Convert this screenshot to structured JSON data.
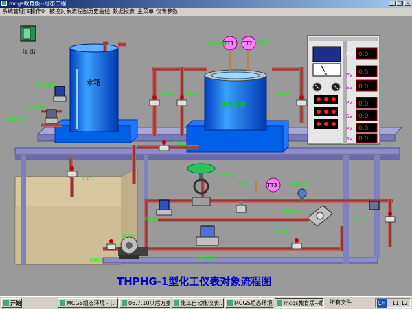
{
  "window": {
    "title": "mcgs教育版--组态工程",
    "minimize": "_",
    "maximize": "□",
    "close": "×"
  },
  "menu": {
    "items": [
      "系统管理[S]",
      "操作0",
      "被控对象流程图",
      "历史曲线",
      "数据报表",
      "主菜单",
      "仪表参数"
    ]
  },
  "diagram": {
    "title": "THPHG-1型化工仪表对象流程图",
    "exit_label": "退 出",
    "tanks": {
      "water_tank": "水箱",
      "reactor": "夹套水箱"
    },
    "sensors": {
      "tt1": "TT1",
      "tt2": "TT2",
      "tt3": "TT3"
    },
    "flow_tags": {
      "f1_3": "F1-3",
      "f1_4": "F1-4",
      "f1_5": "F1-5",
      "f1_6": "F1-6",
      "f1_7": "F1-7",
      "f1_1": "F1-1",
      "f1_2": "F1-2"
    },
    "device_labels": {
      "motor_valve": "电动调节阀",
      "inlet_valve": "进水电磁阀",
      "drain_valve": "泄水电磁阀",
      "level_sensor": "液位变送器",
      "temp_sensor": "温度传感器",
      "pressure": "压力变送器",
      "turbine": "涡轮流量计",
      "electromag": "电磁流量计",
      "pump": "磁力泵",
      "heater": "加热器",
      "cooling": "冷却水",
      "elec_valve": "电磁阀",
      "flow_sensor": "流量计"
    }
  },
  "panel": {
    "display_1": "0.0",
    "display_2": "0.0",
    "display_3": "0.0",
    "display_4": "0.0",
    "display_5": "0.0",
    "display_6": "0.0",
    "display_7": "0.0",
    "pv": "PV",
    "sv": "SV"
  },
  "taskbar": {
    "start": "开始",
    "tasks": [
      "MCGS组态环境 - [...",
      "06.7.10以后方案",
      "化工自动化仪表...",
      "MCGS组态环境 - [...",
      "mcgs教育版--组..."
    ],
    "all_files": "所有文件",
    "lang": "CH",
    "time": "11:12"
  },
  "colors": {
    "tank_blue": "#1E78FF",
    "pipe": "#A0504A",
    "frame": "#8080C0",
    "label_green": "#00CC00",
    "title_blue": "#0000CC"
  }
}
